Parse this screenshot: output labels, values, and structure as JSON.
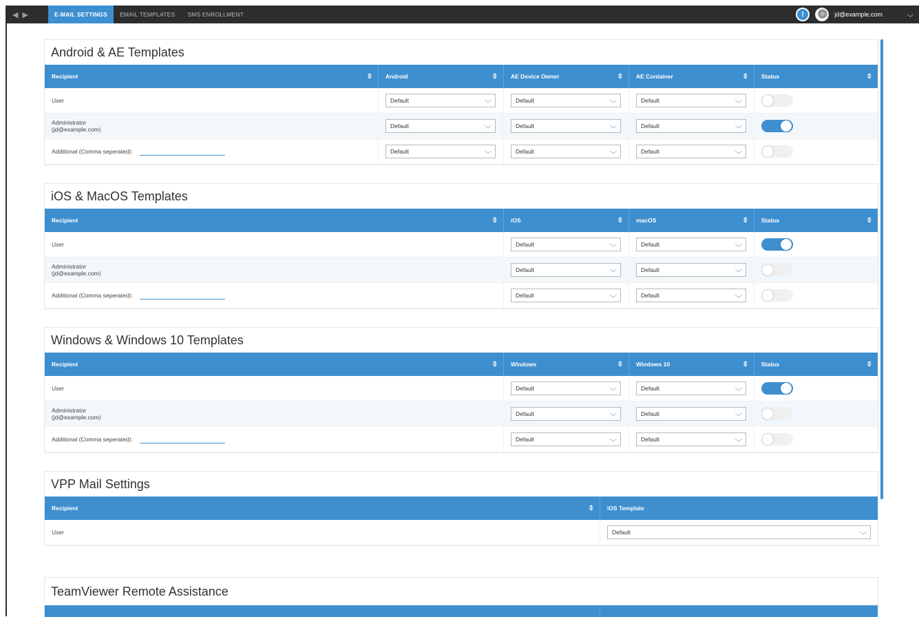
{
  "nav": {
    "back": "◀",
    "forward": "▶"
  },
  "tabs": [
    {
      "label": "E-MAIL SETTINGS",
      "active": true
    },
    {
      "label": "EMAIL TEMPLATES",
      "active": false
    },
    {
      "label": "SMS ENROLLMENT",
      "active": false
    }
  ],
  "user": {
    "alert_glyph": "!",
    "email": "jd@example.com",
    "menu_glyph": "⌵"
  },
  "common": {
    "sort_glyph": "⇳",
    "select_glyph": "⌵"
  },
  "android": {
    "title": "Android & AE Templates",
    "headers": [
      "Recipient",
      "Android",
      "AE Device Owner",
      "AE Container",
      "Status"
    ],
    "rows": [
      {
        "label1": "User",
        "label2": "",
        "values": [
          "Default",
          "Default",
          "Default"
        ],
        "status": "off"
      },
      {
        "label1": "Administrator",
        "label2": "(jd@example.com)",
        "values": [
          "Default",
          "Default",
          "Default"
        ],
        "status": "on"
      },
      {
        "label1": "Additional (Comma seperated):",
        "label2": "",
        "values": [
          "Default",
          "Default",
          "Default"
        ],
        "status": "off"
      }
    ]
  },
  "ios": {
    "title": "iOS & MacOS Templates",
    "headers": [
      "Recipient",
      "iOS",
      "macOS",
      "Status"
    ],
    "rows": [
      {
        "label1": "User",
        "label2": "",
        "values": [
          "Default",
          "Default"
        ],
        "status": "on"
      },
      {
        "label1": "Administrator",
        "label2": "(jd@example.com)",
        "values": [
          "Default",
          "Default"
        ],
        "status": "off"
      },
      {
        "label1": "Additional (Comma seperated):",
        "label2": "",
        "values": [
          "Default",
          "Default"
        ],
        "status": "off"
      }
    ]
  },
  "windows": {
    "title": "Windows & Windows 10 Templates",
    "headers": [
      "Recipient",
      "Windows",
      "Windows 10",
      "Status"
    ],
    "rows": [
      {
        "label1": "User",
        "label2": "",
        "values": [
          "Default",
          "Default"
        ],
        "status": "on"
      },
      {
        "label1": "Administrator",
        "label2": "(jd@example.com)",
        "values": [
          "Default",
          "Default"
        ],
        "status": "off"
      },
      {
        "label1": "Additional (Comma seperated):",
        "label2": "",
        "values": [
          "Default",
          "Default"
        ],
        "status": "off"
      }
    ]
  },
  "vpp": {
    "title": "VPP Mail Settings",
    "headers": [
      "Recipient",
      "iOS Template"
    ],
    "rows": [
      {
        "label1": "User",
        "values": [
          "Default"
        ]
      }
    ]
  },
  "teamviewer": {
    "title": "TeamViewer Remote Assistance"
  },
  "colors": {
    "accent": "#3e8fd0",
    "topbar": "#2d2d2d"
  }
}
